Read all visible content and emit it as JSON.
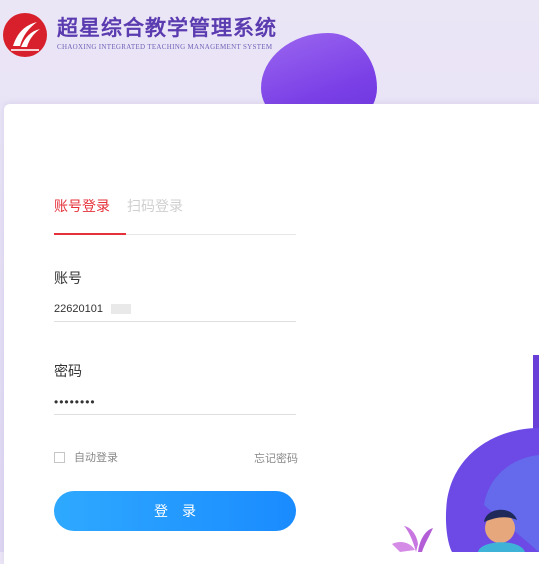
{
  "brand": {
    "title": "超星综合教学管理系统",
    "subtitle": "CHAOXING INTEGRATED TEACHING MANAGEMENT SYSTEM"
  },
  "tabs": [
    {
      "label": "账号登录",
      "active": true
    },
    {
      "label": "扫码登录",
      "active": false
    }
  ],
  "form": {
    "account_label": "账号",
    "account_value": "22620101",
    "password_label": "密码",
    "password_value": "••••••••",
    "remember_label": "自动登录",
    "remember_checked": false,
    "forgot_label": "忘记密码",
    "login_label": "登录"
  },
  "colors": {
    "accent_red": "#e5323a",
    "button_blue": "#1a8bff",
    "brand_purple": "#5b3bb0"
  }
}
